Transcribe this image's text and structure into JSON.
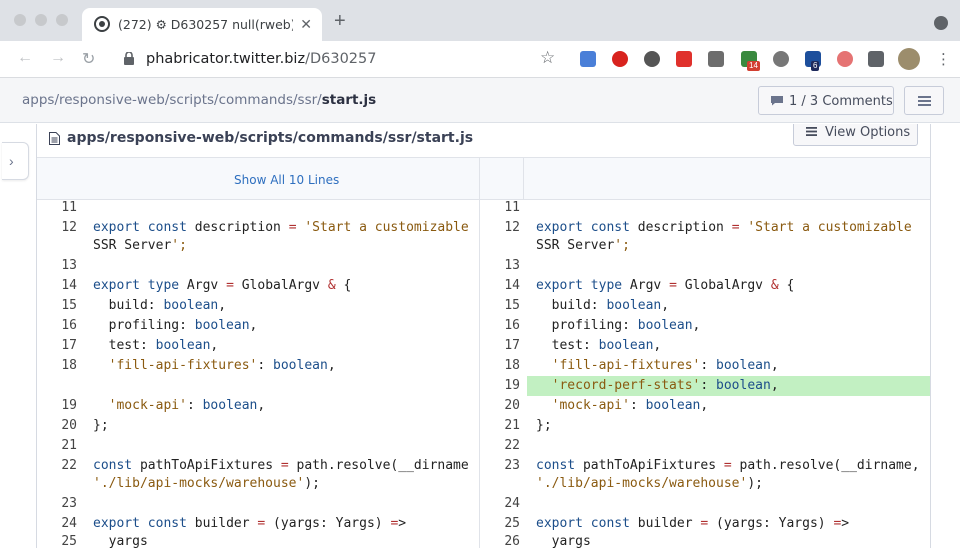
{
  "browser": {
    "tab_title": "(272) ⚙ D630257 null(rweb):",
    "tab_close": "✕",
    "new_tab": "+",
    "url_host": "phabricator.twitter.biz",
    "url_path": "/D630257",
    "star": "☆",
    "menu": "⋮",
    "extensions": [
      {
        "name": "translate-extension-icon",
        "color": "#4a7fd8"
      },
      {
        "name": "adblock-extension-icon",
        "color": "#d8231e"
      },
      {
        "name": "info-extension-icon",
        "color": "#555555"
      },
      {
        "name": "tp-extension-icon",
        "color": "#e0312c"
      },
      {
        "name": "p-extension-icon",
        "color": "#6d6d6d"
      },
      {
        "name": "grid-extension-icon",
        "color": "#3a8a3f",
        "badge": "14",
        "badge_color": "#d23f31"
      },
      {
        "name": "messenger-extension-icon",
        "color": "#777777"
      },
      {
        "name": "bird-extension-icon",
        "color": "#1d4f9c",
        "badge": "6",
        "badge_color": "#1e2a5c"
      },
      {
        "name": "flower-extension-icon",
        "color": "#e57373"
      },
      {
        "name": "puzzle-extension-icon",
        "color": "#5f6368"
      }
    ]
  },
  "header": {
    "breadcrumb_path": "apps/responsive-web/scripts/commands/ssr/",
    "breadcrumb_file": "start.js",
    "comments_label": "1 / 3 Comments"
  },
  "file": {
    "path": "apps/responsive-web/scripts/commands/ssr/start.js",
    "view_options": "View Options",
    "show_all": "Show All 10 Lines"
  },
  "diff": {
    "left": [
      {
        "n": "11",
        "code": ""
      },
      {
        "n": "12",
        "code": "export const description = 'Start a customizable"
      },
      {
        "n": "",
        "code": "SSR Server';"
      },
      {
        "n": "13",
        "code": ""
      },
      {
        "n": "14",
        "code": "export type Argv = GlobalArgv & {"
      },
      {
        "n": "15",
        "code": "  build: boolean,"
      },
      {
        "n": "16",
        "code": "  profiling: boolean,"
      },
      {
        "n": "17",
        "code": "  test: boolean,"
      },
      {
        "n": "18",
        "code": "  'fill-api-fixtures': boolean,"
      },
      {
        "n": "",
        "code": ""
      },
      {
        "n": "19",
        "code": "  'mock-api': boolean,"
      },
      {
        "n": "20",
        "code": "};"
      },
      {
        "n": "21",
        "code": ""
      },
      {
        "n": "22",
        "code": "const pathToApiFixtures = path.resolve(__dirname"
      },
      {
        "n": "",
        "code": "'./lib/api-mocks/warehouse');"
      },
      {
        "n": "23",
        "code": ""
      },
      {
        "n": "24",
        "code": "export const builder = (yargs: Yargs) =>"
      },
      {
        "n": "25",
        "code": "  yargs"
      }
    ],
    "right": [
      {
        "n": "11",
        "code": ""
      },
      {
        "n": "12",
        "code": "export const description = 'Start a customizable"
      },
      {
        "n": "",
        "code": "SSR Server';"
      },
      {
        "n": "13",
        "code": ""
      },
      {
        "n": "14",
        "code": "export type Argv = GlobalArgv & {"
      },
      {
        "n": "15",
        "code": "  build: boolean,"
      },
      {
        "n": "16",
        "code": "  profiling: boolean,"
      },
      {
        "n": "17",
        "code": "  test: boolean,"
      },
      {
        "n": "18",
        "code": "  'fill-api-fixtures': boolean,"
      },
      {
        "n": "19",
        "code": "  'record-perf-stats': boolean,",
        "added": true
      },
      {
        "n": "20",
        "code": "  'mock-api': boolean,"
      },
      {
        "n": "21",
        "code": "};"
      },
      {
        "n": "22",
        "code": ""
      },
      {
        "n": "23",
        "code": "const pathToApiFixtures = path.resolve(__dirname,"
      },
      {
        "n": "",
        "code": "'./lib/api-mocks/warehouse');"
      },
      {
        "n": "24",
        "code": ""
      },
      {
        "n": "25",
        "code": "export const builder = (yargs: Yargs) =>"
      },
      {
        "n": "26",
        "code": "  yargs"
      }
    ]
  }
}
